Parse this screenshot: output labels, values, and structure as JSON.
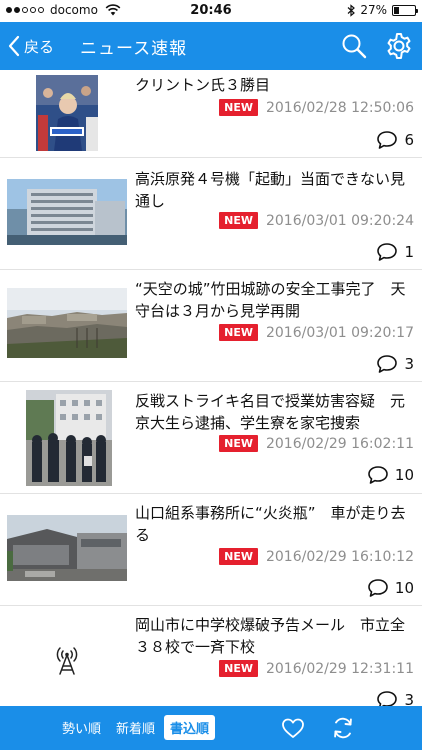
{
  "status_bar": {
    "signal_dots_filled": 2,
    "signal_dots_total": 5,
    "carrier": "docomo",
    "time": "20:46",
    "battery_percent": "27%",
    "battery_level": 0.27,
    "icons": [
      "wifi-icon",
      "bluetooth-icon",
      "battery-icon"
    ]
  },
  "navbar": {
    "back_label": "戻る",
    "title": "ニュース速報",
    "icons": [
      "chevron-left-icon",
      "search-icon",
      "gear-icon"
    ]
  },
  "news_items": [
    {
      "title": "クリントン氏３勝目",
      "badge": "NEW",
      "datetime": "2016/02/28 12:50:06",
      "comments": "6",
      "thumbnail": "photo-clinton-rally"
    },
    {
      "title": "高浜原発４号機「起動」当面できない見通し",
      "badge": "NEW",
      "datetime": "2016/03/01 09:20:24",
      "comments": "1",
      "thumbnail": "photo-power-plant"
    },
    {
      "title": "“天空の城”竹田城跡の安全工事完了　天守台は３月から見学再開",
      "badge": "NEW",
      "datetime": "2016/03/01 09:20:17",
      "comments": "3",
      "thumbnail": "photo-castle-ruins"
    },
    {
      "title": "反戦ストライキ名目で授業妨害容疑　元京大生ら逮捕、学生寮を家宅捜索",
      "badge": "NEW",
      "datetime": "2016/02/29 16:02:11",
      "comments": "10",
      "thumbnail": "photo-police-crowd"
    },
    {
      "title": "山口組系事務所に“火炎瓶”　車が走り去る",
      "badge": "NEW",
      "datetime": "2016/02/29 16:10:12",
      "comments": "10",
      "thumbnail": "photo-building-street"
    },
    {
      "title": "岡山市に中学校爆破予告メール　市立全３８校で一斉下校",
      "badge": "NEW",
      "datetime": "2016/02/29 12:31:11",
      "comments": "3",
      "thumbnail": "antenna-icon"
    }
  ],
  "tabbar": {
    "tabs": [
      {
        "label": "勢い順",
        "selected": false
      },
      {
        "label": "新着順",
        "selected": false
      },
      {
        "label": "書込順",
        "selected": true
      }
    ],
    "icons": [
      "heart-icon",
      "refresh-icon"
    ]
  },
  "colors": {
    "accent": "#1a8ee8",
    "badge": "#e5202e",
    "date_text": "#8e8e8e"
  }
}
